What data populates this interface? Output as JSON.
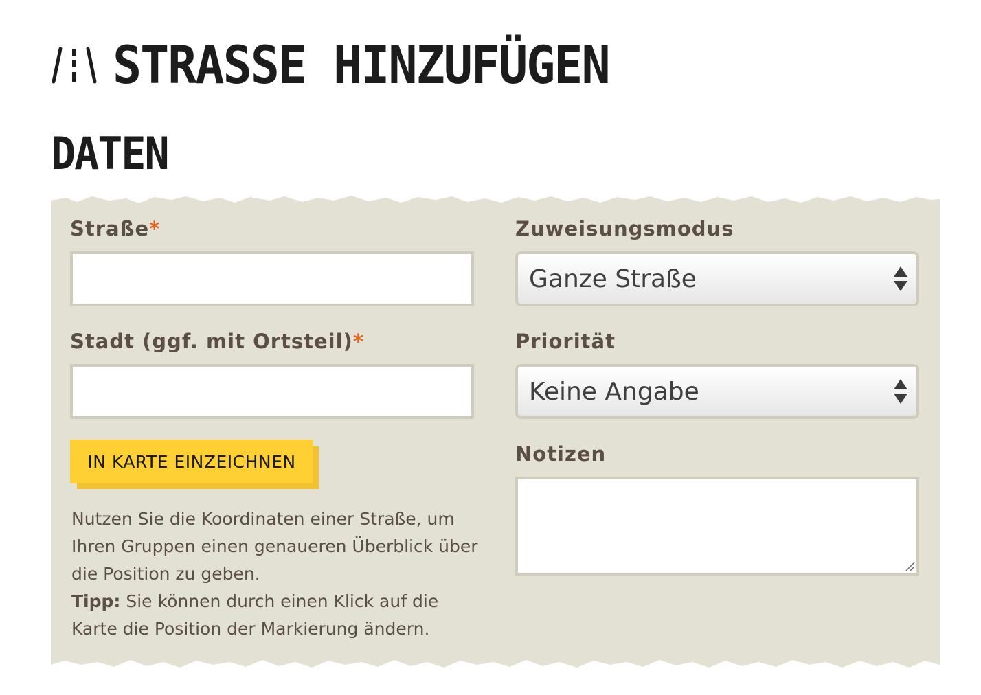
{
  "header": {
    "title": "STRASSE HINZUFÜGEN",
    "icon": "road-icon"
  },
  "section": {
    "title": "DATEN"
  },
  "form": {
    "street": {
      "label": "Straße",
      "required_mark": "*",
      "value": "",
      "placeholder": ""
    },
    "city": {
      "label": "Stadt (ggf. mit Ortsteil)",
      "required_mark": "*",
      "value": "",
      "placeholder": ""
    },
    "draw_button": {
      "label": "IN KARTE EINZEICHNEN"
    },
    "help": {
      "text": "Nutzen Sie die Koordinaten einer Straße, um Ihren Gruppen einen genaueren Überblick über die Position zu geben.",
      "tip_label": "Tipp:",
      "tip_text": " Sie können durch einen Klick auf die Karte die Position der Markierung ändern."
    },
    "assignment_mode": {
      "label": "Zuweisungsmodus",
      "selected": "Ganze Straße"
    },
    "priority": {
      "label": "Priorität",
      "selected": "Keine Angabe"
    },
    "notes": {
      "label": "Notizen",
      "value": ""
    }
  },
  "colors": {
    "panel_background": "#e3e1d4",
    "label_text": "#5b4e46",
    "required_mark": "#e0621d",
    "button_yellow": "#fed033",
    "button_shadow": "#f2c232",
    "input_border": "#cfcbbd"
  }
}
